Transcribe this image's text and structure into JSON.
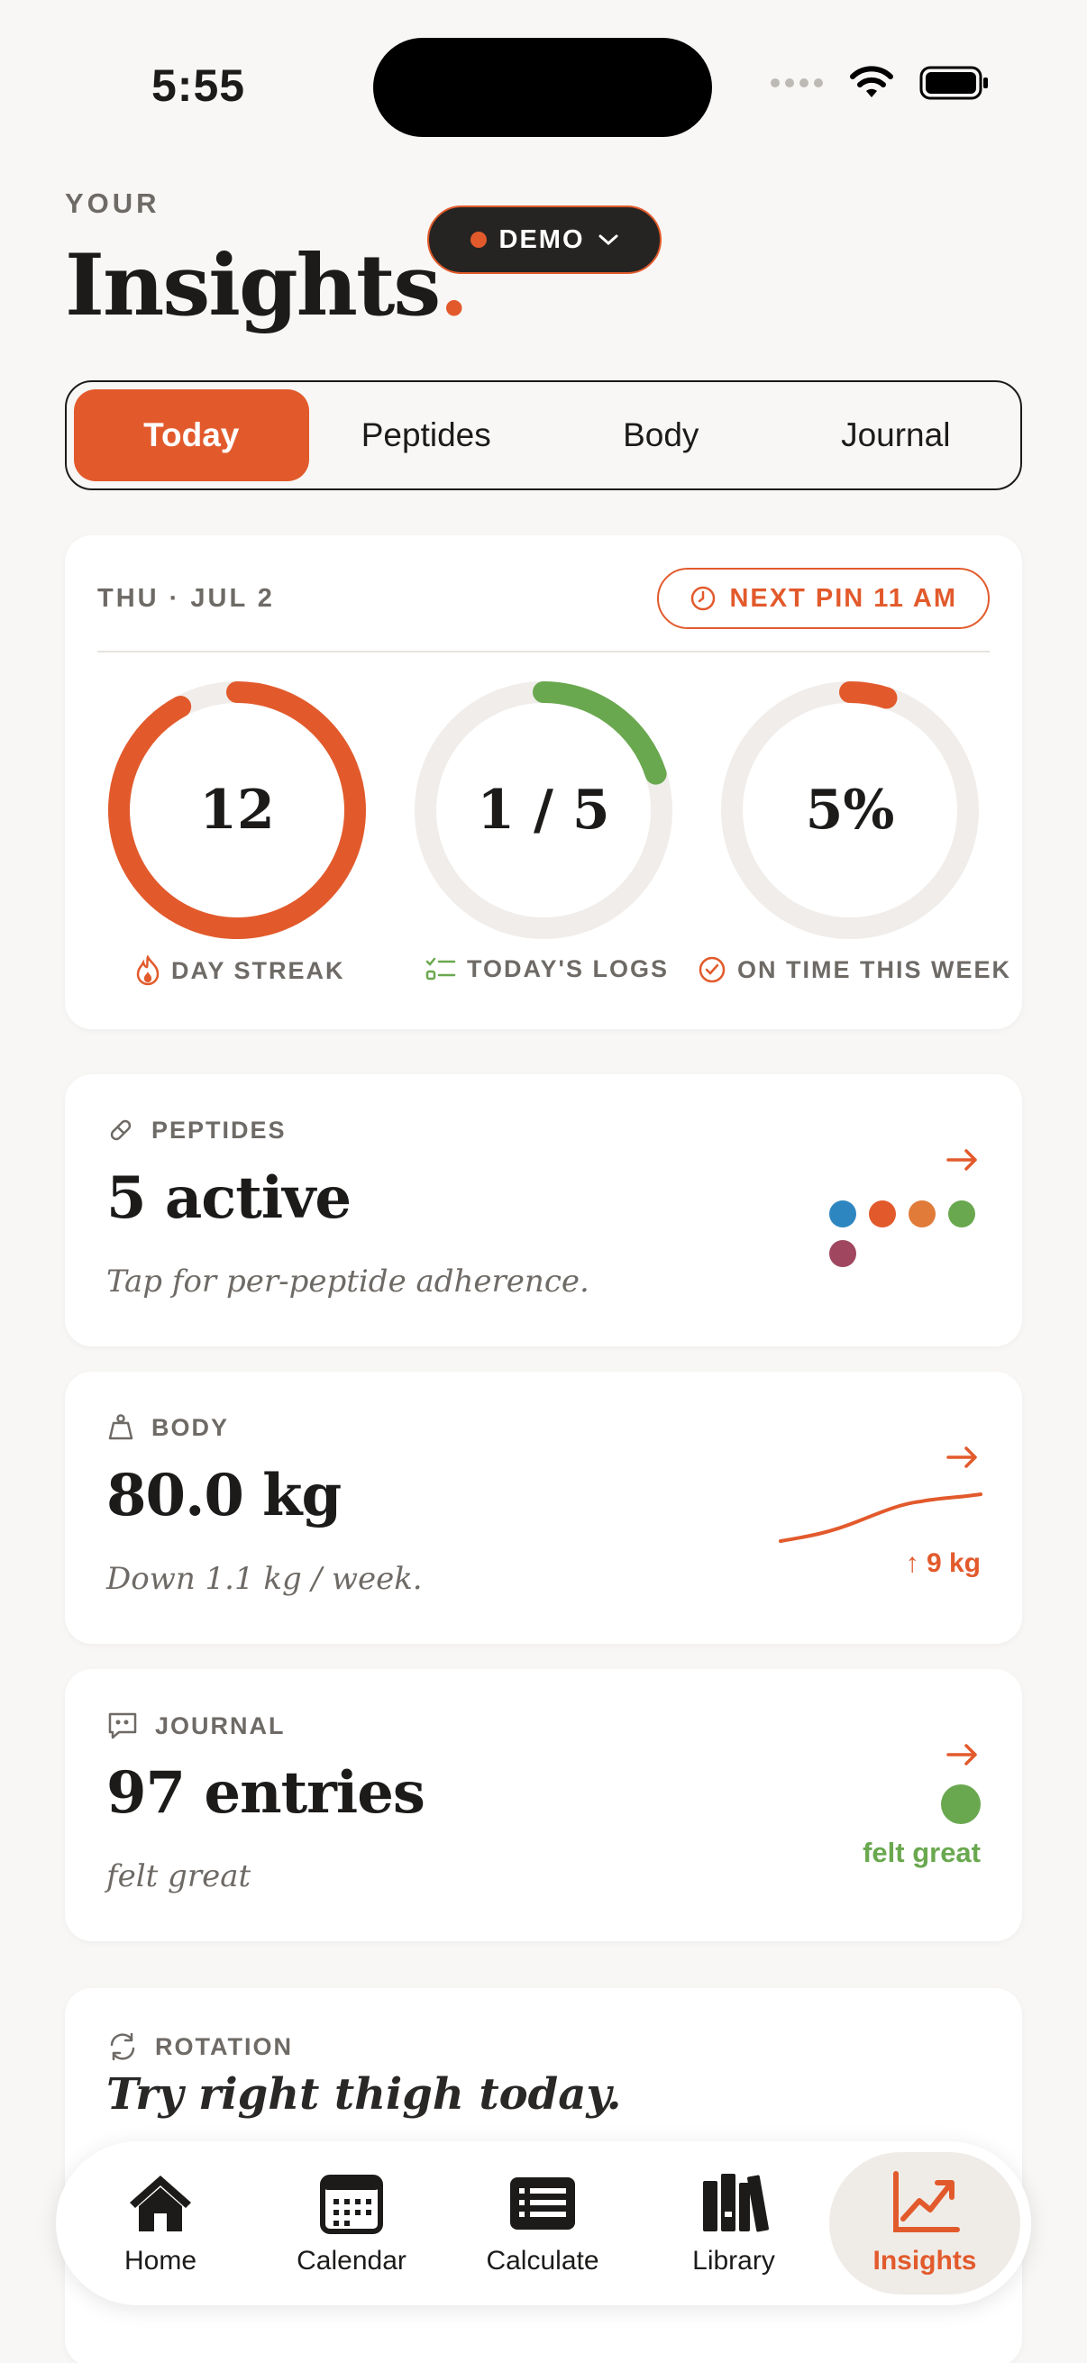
{
  "status_bar": {
    "time": "5:55"
  },
  "header": {
    "eyebrow": "YOUR",
    "title": "Insights",
    "title_dot": ".",
    "demo_label": "DEMO"
  },
  "tabs": [
    {
      "label": "Today",
      "active": true
    },
    {
      "label": "Peptides",
      "active": false
    },
    {
      "label": "Body",
      "active": false
    },
    {
      "label": "Journal",
      "active": false
    }
  ],
  "today": {
    "date": "THU · JUL 2",
    "next_pin": "NEXT PIN 11 AM",
    "rings": [
      {
        "value": "12",
        "label": "DAY STREAK",
        "progress": 0.92,
        "color": "#e25a2c"
      },
      {
        "value": "1 / 5",
        "label": "TODAY'S LOGS",
        "progress": 0.2,
        "color": "#6aa84f"
      },
      {
        "value": "5%",
        "label": "ON TIME THIS WEEK",
        "progress": 0.05,
        "color": "#e25a2c"
      }
    ]
  },
  "peptides_card": {
    "kicker": "PEPTIDES",
    "headline": "5 active",
    "sub": "Tap for per-peptide adherence.",
    "dot_colors": [
      "#2e86c1",
      "#e25a2c",
      "#e07b39",
      "#6aa84f",
      "#a0465f"
    ]
  },
  "body_card": {
    "kicker": "BODY",
    "headline": "80.0 kg",
    "sub": "Down 1.1 kg / week.",
    "delta": "↑ 9 kg"
  },
  "journal_card": {
    "kicker": "JOURNAL",
    "headline": "97 entries",
    "sub": "felt great",
    "mood": "felt great"
  },
  "rotation_card": {
    "kicker": "ROTATION",
    "headline": "Try right thigh today."
  },
  "nav": [
    {
      "label": "Home",
      "icon": "home-icon",
      "active": false
    },
    {
      "label": "Calendar",
      "icon": "calendar-icon",
      "active": false
    },
    {
      "label": "Calculate",
      "icon": "calculate-icon",
      "active": false
    },
    {
      "label": "Library",
      "icon": "library-icon",
      "active": false
    },
    {
      "label": "Insights",
      "icon": "insights-icon",
      "active": true
    }
  ],
  "colors": {
    "accent": "#e25a2c",
    "green": "#6aa84f",
    "background": "#f8f7f5"
  }
}
